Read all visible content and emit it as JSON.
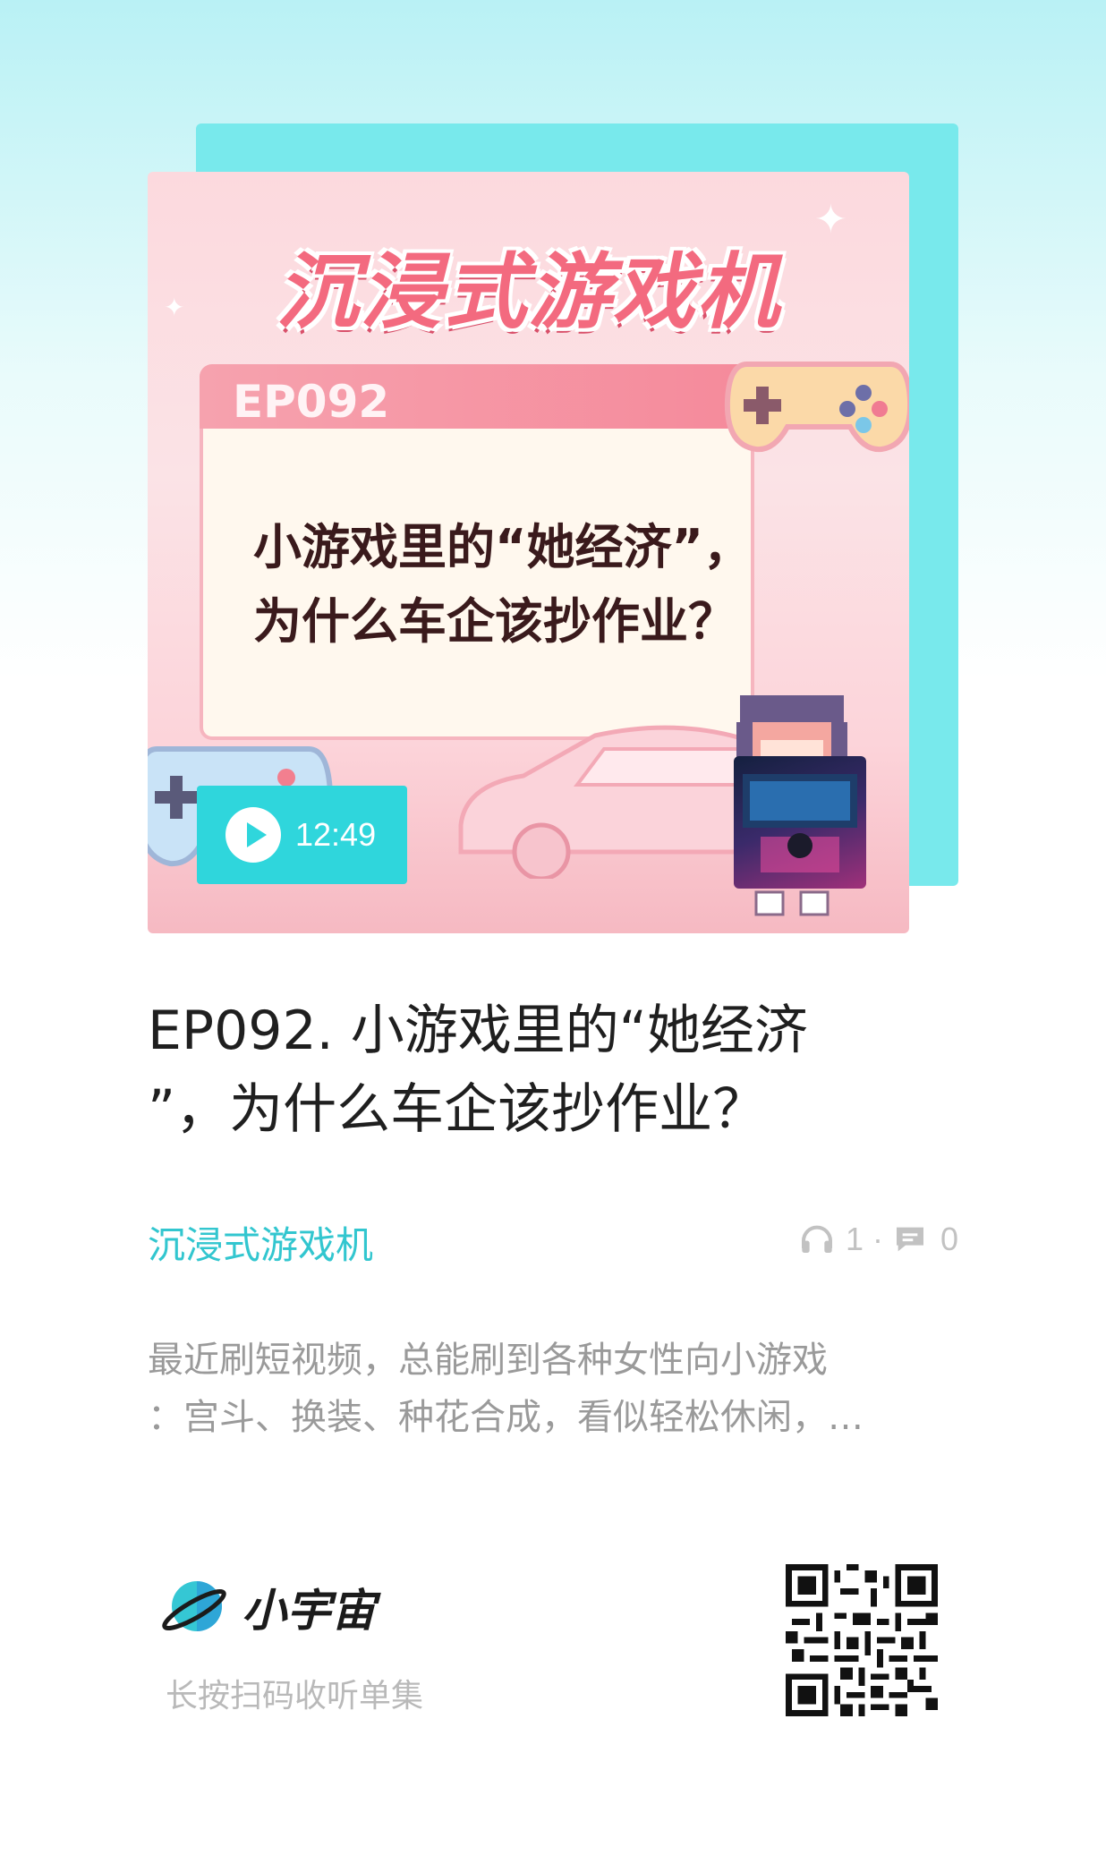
{
  "cover": {
    "series_title": "沉浸式游戏机",
    "episode_tag": "EP092",
    "headline_line1": "小游戏里的“她经济”，",
    "headline_line2": "为什么车企该抄作业？",
    "duration": "12:49",
    "play_icon": "play-icon"
  },
  "episode": {
    "title_line1": "EP092. 小游戏里的“她经济",
    "title_line2": "”，为什么车企该抄作业？"
  },
  "meta": {
    "podcast_name": "沉浸式游戏机",
    "listen_count": "1",
    "dot": "·",
    "comment_count": "0",
    "listen_icon": "headphones-icon",
    "comment_icon": "comment-icon"
  },
  "description": {
    "line1": "最近刷短视频，总能刷到各种女性向小游戏",
    "line2": "：宫斗、换装、种花合成，看似轻松休闲，…"
  },
  "footer": {
    "brand_name": "小宇宙",
    "scan_hint": "长按扫码收听单集",
    "logo_icon": "planet-logo-icon"
  },
  "colors": {
    "accent": "#32c6cf",
    "cover_pink": "#f36a7f",
    "text_dark": "#1f1f1f",
    "text_muted": "#9a9a9a"
  }
}
